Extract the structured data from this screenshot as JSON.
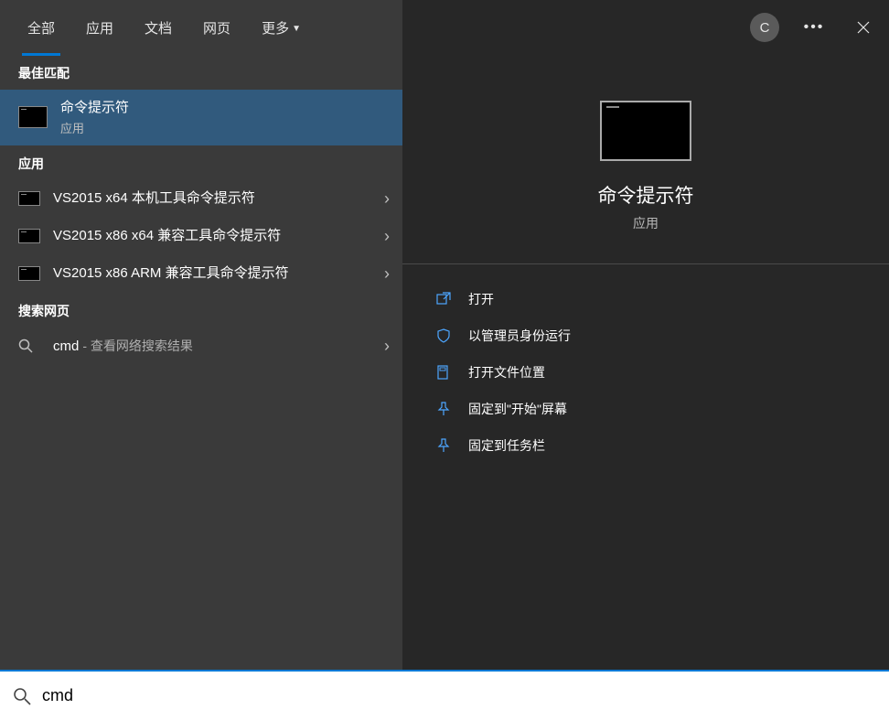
{
  "tabs": {
    "all": "全部",
    "apps": "应用",
    "docs": "文档",
    "web": "网页",
    "more": "更多"
  },
  "user_initial": "C",
  "sections": {
    "best_match": "最佳匹配",
    "apps": "应用",
    "search_web": "搜索网页"
  },
  "best_match": {
    "title": "命令提示符",
    "subtitle": "应用"
  },
  "app_results": [
    {
      "title": "VS2015 x64 本机工具命令提示符"
    },
    {
      "title": "VS2015 x86 x64 兼容工具命令提示符"
    },
    {
      "title": "VS2015 x86 ARM 兼容工具命令提示符"
    }
  ],
  "web_result": {
    "query": "cmd",
    "suffix": "- 查看网络搜索结果"
  },
  "preview": {
    "title": "命令提示符",
    "subtitle": "应用"
  },
  "actions": {
    "open": "打开",
    "run_admin": "以管理员身份运行",
    "open_location": "打开文件位置",
    "pin_start": "固定到\"开始\"屏幕",
    "pin_taskbar": "固定到任务栏"
  },
  "search_input": "cmd"
}
